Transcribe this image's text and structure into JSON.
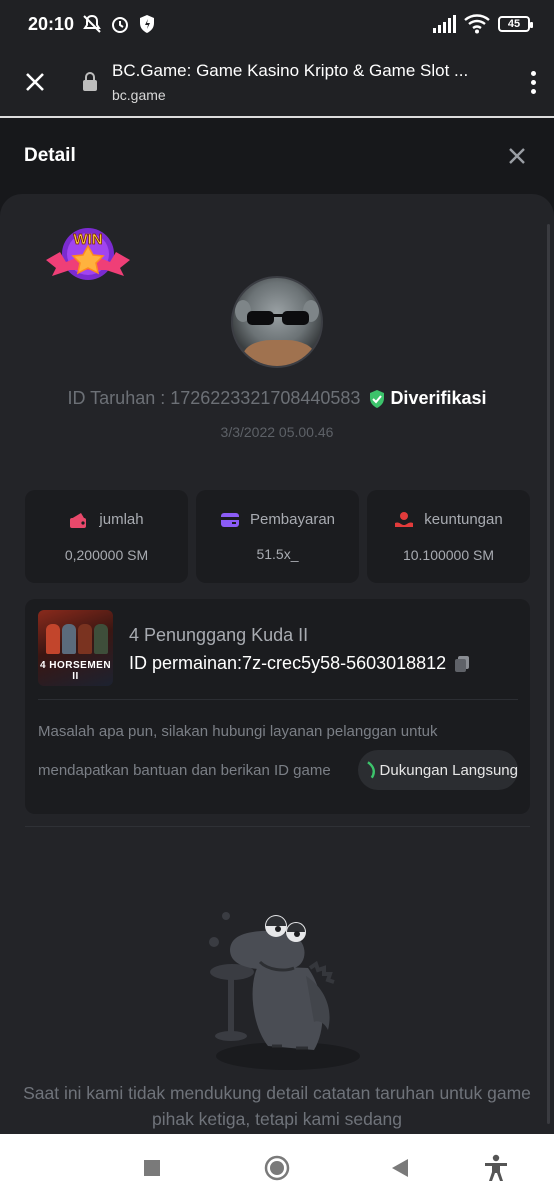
{
  "status_bar": {
    "time": "20:10",
    "battery": "45",
    "icons": [
      "mute-icon",
      "alarm-icon",
      "shield-icon",
      "signal-icon",
      "wifi-icon",
      "battery-icon"
    ]
  },
  "browser": {
    "title": "BC.Game: Game Kasino Kripto & Game Slot ...",
    "domain": "bc.game"
  },
  "detail": {
    "title": "Detail"
  },
  "bet": {
    "id_text": "ID Taruhan : 1726223321708440583",
    "verified_label": "Diverifikasi",
    "date": "3/3/2022 05.00.46"
  },
  "stats": [
    {
      "label": "jumlah",
      "value": "0,200000 SM",
      "icon": "wallet-icon",
      "color": "#e8496b"
    },
    {
      "label": "Pembayaran",
      "value": "51.5x_",
      "icon": "card-icon",
      "color": "#8b5cf6"
    },
    {
      "label": "keuntungan",
      "value": "10.100000 SM",
      "icon": "profit-icon",
      "color": "#e23b3b"
    }
  ],
  "game": {
    "name": "4 Penunggang Kuda II",
    "id_text": "ID permainan:7z-crec5y58-5603018812",
    "thumb_text": "4 HORSEMEN II"
  },
  "support": {
    "line1": "Masalah apa pun, silakan hubungi layanan pelanggan untuk",
    "line2": "mendapatkan bantuan dan berikan ID game",
    "button_label": "Dukungan Langsung"
  },
  "notice": {
    "text": "Saat ini kami tidak mendukung detail catatan taruhan untuk game pihak ketiga, tetapi kami sedang"
  },
  "win_badge": {
    "label": "WIN"
  },
  "colors": {
    "accent_green": "#3cc36b",
    "panel": "#232428",
    "background": "#17181b"
  }
}
